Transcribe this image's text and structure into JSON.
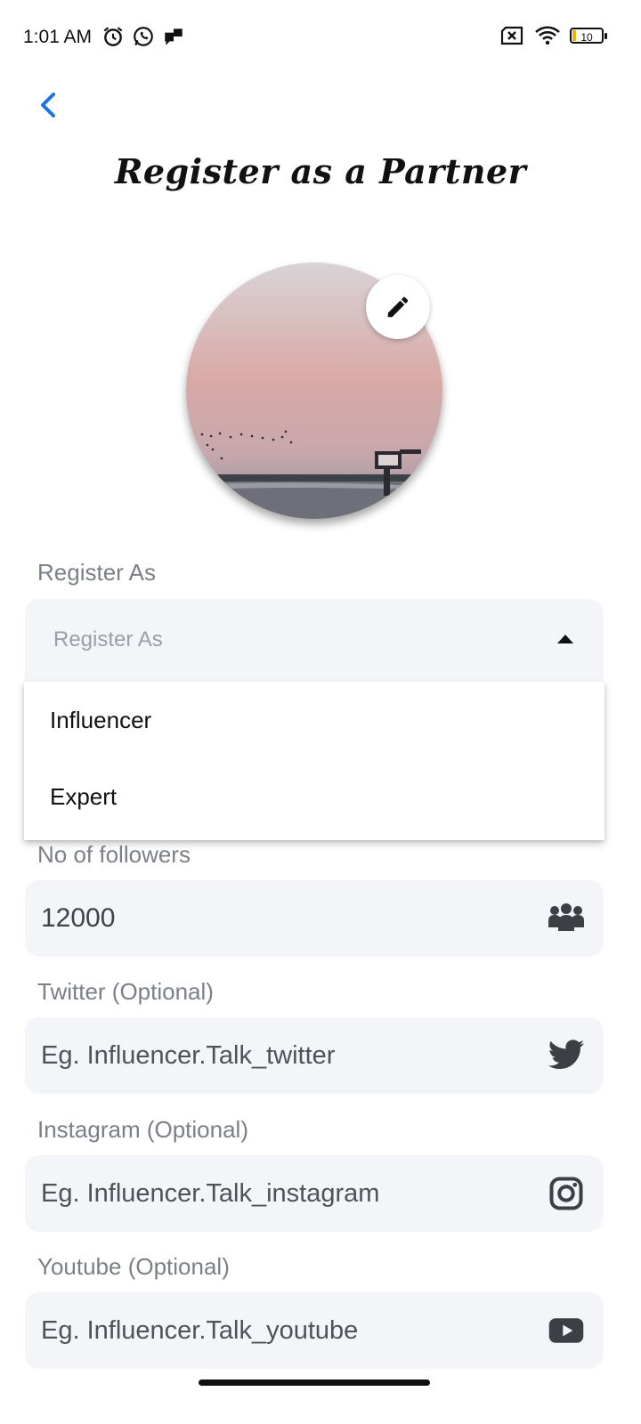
{
  "status_bar": {
    "time": "1:01 AM",
    "battery_level": "10",
    "icons": [
      "alarm-icon",
      "whatsapp-icon",
      "chat-icon",
      "sim-off-icon",
      "wifi-icon",
      "battery-icon"
    ]
  },
  "header": {
    "title": "Register as a Partner",
    "back_icon": "chevron-left-icon"
  },
  "colors": {
    "accent": "#1a73e8",
    "field_bg": "#f4f5f9",
    "label": "#7b7f86"
  },
  "form": {
    "register_as": {
      "label": "Register As",
      "placeholder": "Register As",
      "options": [
        "Influencer",
        "Expert"
      ]
    },
    "followers": {
      "label": "No of followers",
      "value": "12000",
      "icon": "people-group-icon"
    },
    "twitter": {
      "label": "Twitter (Optional)",
      "placeholder": "Eg. Influencer.Talk_twitter",
      "icon": "twitter-icon"
    },
    "instagram": {
      "label": "Instagram (Optional)",
      "placeholder": "Eg. Influencer.Talk_instagram",
      "icon": "instagram-icon"
    },
    "youtube": {
      "label": "Youtube (Optional)",
      "placeholder": "Eg. Influencer.Talk_youtube",
      "icon": "youtube-icon"
    }
  }
}
